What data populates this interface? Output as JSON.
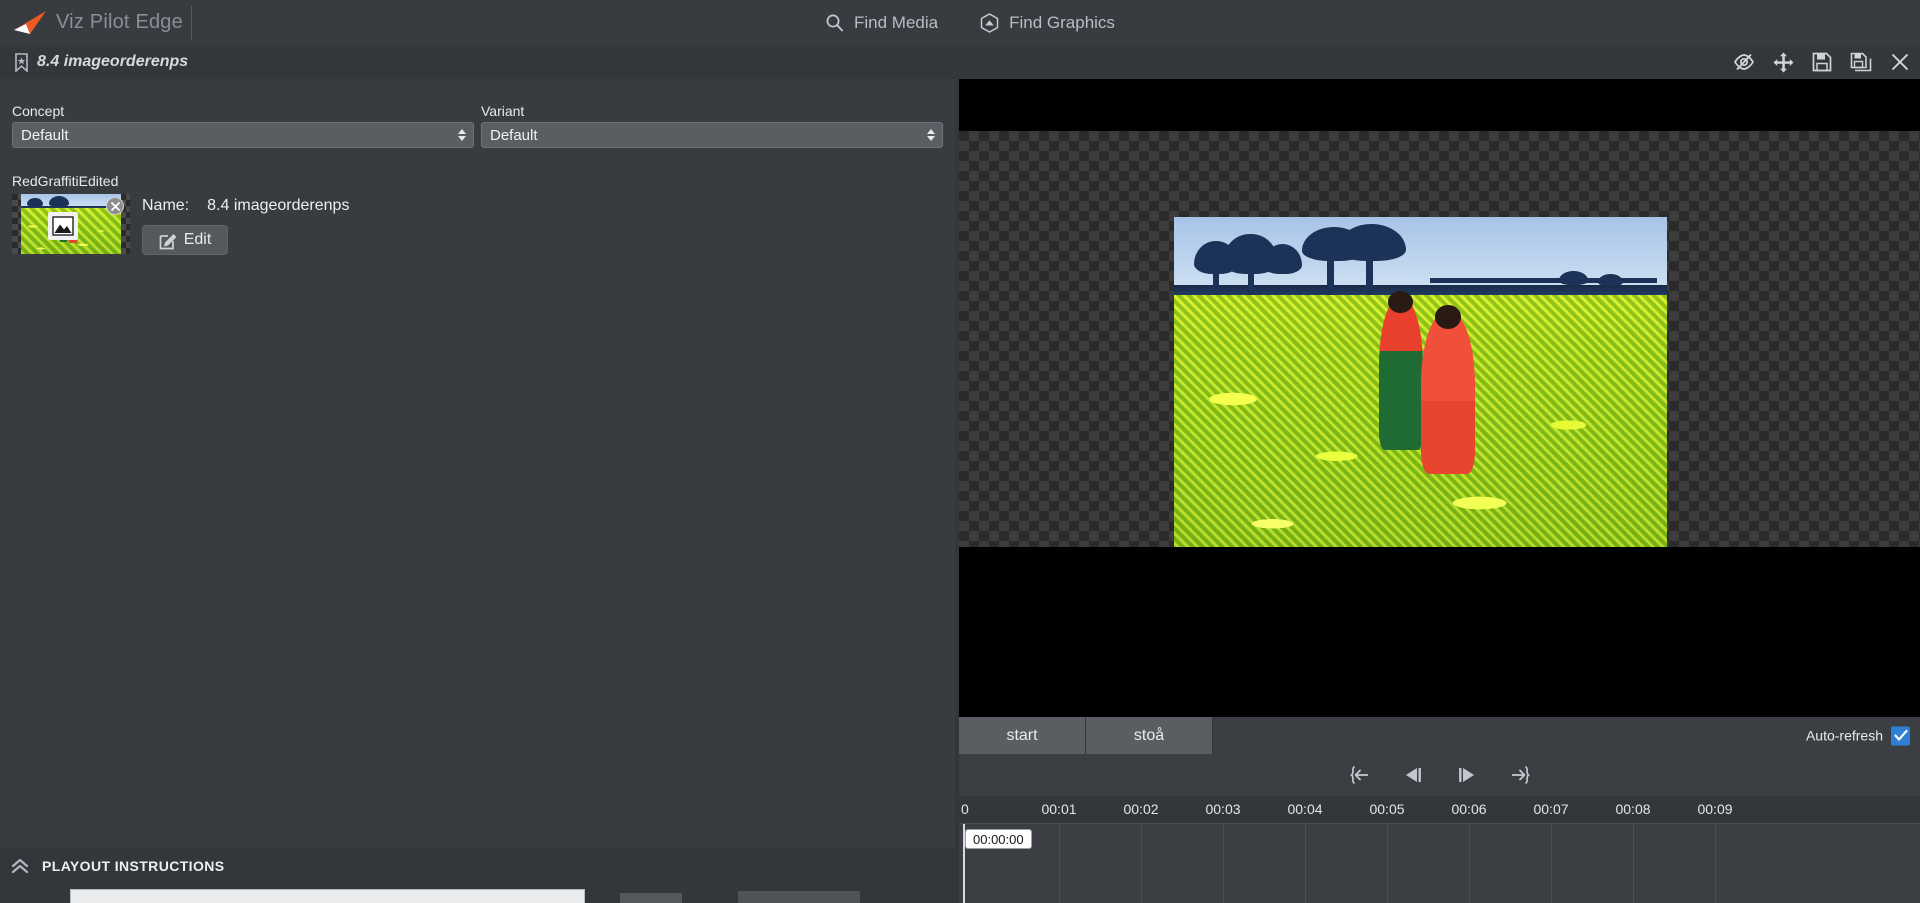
{
  "app": {
    "brand_name": "Viz Pilot Edge",
    "logo_icon": "arrow-logo-icon",
    "accent_color": "#ee5a24",
    "bg_color": "#33363b",
    "panel_color": "#383b40"
  },
  "topnav": {
    "items": [
      {
        "label": "Find Media",
        "icon": "search-icon",
        "name": "nav-find-media"
      },
      {
        "label": "Find Graphics",
        "icon": "hexagon-graphics-icon",
        "name": "nav-find-graphics"
      }
    ]
  },
  "subbar": {
    "doc_icon": "bookmark-star-icon",
    "doc_title": "8.4 imageorderenps",
    "window_controls": [
      {
        "name": "hide-preview-icon",
        "icon": "eye-slash-icon",
        "tooltip": "Hide"
      },
      {
        "name": "move-icon",
        "icon": "move-arrows-icon",
        "tooltip": "Move"
      },
      {
        "name": "save-icon",
        "icon": "floppy-save-icon",
        "tooltip": "Save"
      },
      {
        "name": "save-as-icon",
        "icon": "floppy-save-as-icon",
        "tooltip": "Save As"
      },
      {
        "name": "close-icon",
        "icon": "close-x-icon",
        "tooltip": "Close"
      }
    ]
  },
  "form": {
    "concept": {
      "label": "Concept",
      "value": "Default"
    },
    "variant": {
      "label": "Variant",
      "value": "Default"
    }
  },
  "media": {
    "group_label": "RedGraffitiEdited",
    "thumbnail_name": "media-thumbnail",
    "remove_icon": "remove-x-icon",
    "placeholder_icon": "image-placeholder-icon",
    "name_label": "Name:",
    "name_value": "8.4 imageorderenps",
    "edit_button": {
      "label": "Edit",
      "icon": "edit-pencil-icon"
    }
  },
  "playout": {
    "label": "PLAYOUT INSTRUCTIONS",
    "toggle_icon": "chevron-double-up-icon"
  },
  "preview": {
    "image_alt": "two-women-in-yellow-mustard-field"
  },
  "transport": {
    "buttons": [
      {
        "label": "start",
        "name": "start-button"
      },
      {
        "label": "stoå",
        "name": "stop-button"
      }
    ],
    "auto_refresh": {
      "label": "Auto-refresh",
      "checked": true,
      "color": "#2f7fd6"
    },
    "step_buttons": [
      {
        "name": "jump-to-start-button",
        "icon": "jump-start-icon"
      },
      {
        "name": "step-back-button",
        "icon": "step-back-icon"
      },
      {
        "name": "step-forward-button",
        "icon": "step-forward-icon"
      },
      {
        "name": "jump-to-end-button",
        "icon": "jump-end-icon"
      }
    ]
  },
  "timeline": {
    "ticks": [
      "0",
      "00:01",
      "00:02",
      "00:03",
      "00:04",
      "00:05",
      "00:06",
      "00:07",
      "00:08",
      "00:09"
    ],
    "playhead_time": "00:00:00"
  }
}
